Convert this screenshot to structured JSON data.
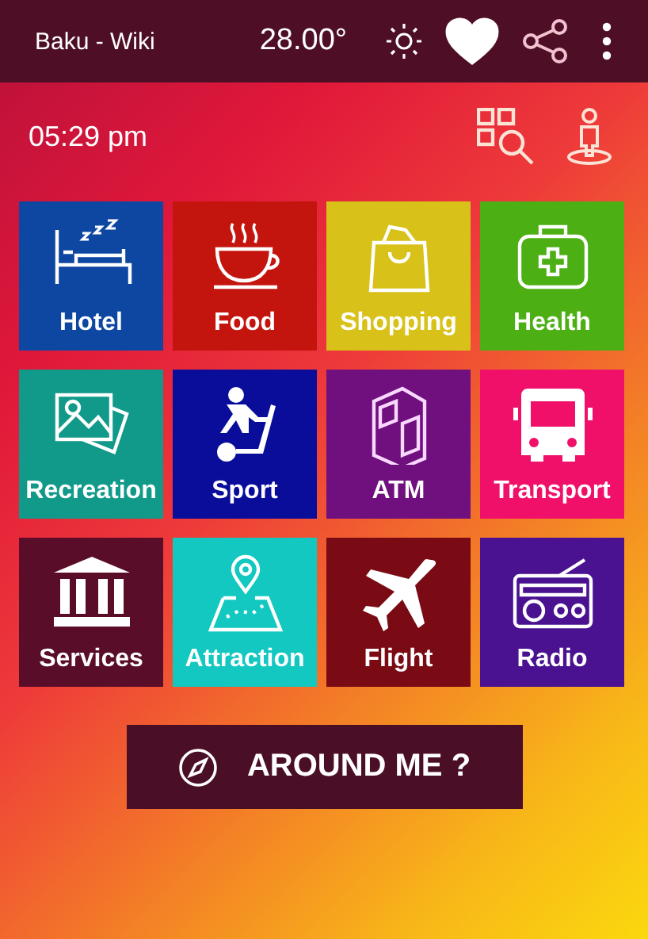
{
  "app_bar": {
    "title": "Baku - Wiki",
    "temperature": "28.00°",
    "favorite": true
  },
  "clock": "05:29 pm",
  "tiles": [
    {
      "label": "Hotel",
      "color": "#0d47a1"
    },
    {
      "label": "Food",
      "color": "#c4140e"
    },
    {
      "label": "Shopping",
      "color": "#d8c118"
    },
    {
      "label": "Health",
      "color": "#4caf14"
    },
    {
      "label": "Recreation",
      "color": "#119a8a"
    },
    {
      "label": "Sport",
      "color": "#0a0d9a"
    },
    {
      "label": "ATM",
      "color": "#700f7e"
    },
    {
      "label": "Transport",
      "color": "#f0106a"
    },
    {
      "label": "Services",
      "color": "#5a0d28"
    },
    {
      "label": "Attraction",
      "color": "#12c8c0"
    },
    {
      "label": "Flight",
      "color": "#7a0a14"
    },
    {
      "label": "Radio",
      "color": "#4a1290"
    }
  ],
  "around_button": {
    "label": "AROUND ME ?"
  }
}
